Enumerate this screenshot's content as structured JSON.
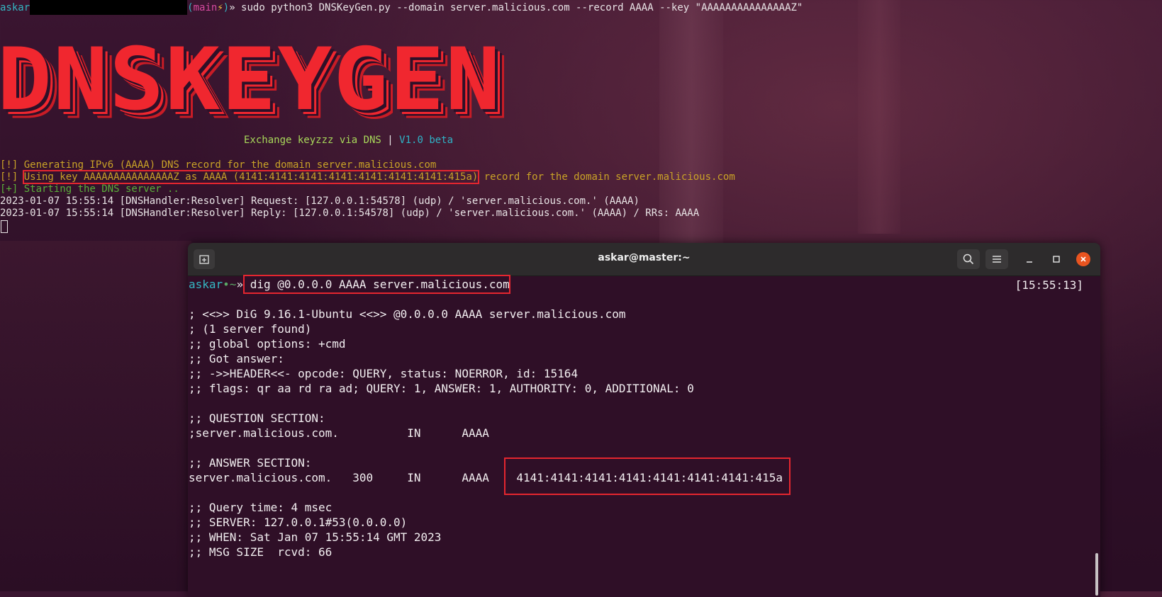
{
  "background_terminal": {
    "prompt_user": "askar",
    "prompt_branch_open": "(",
    "prompt_branch": "main",
    "prompt_bolt": "⚡",
    "prompt_branch_close": ")",
    "prompt_arrow": "»",
    "command": " sudo python3 DNSKeyGen.py --domain server.malicious.com --record AAAA --key \"AAAAAAAAAAAAAAAZ\"",
    "banner": "DNSKEYGEN",
    "tagline_main": "Exchange keyzzz via DNS",
    "tagline_sep": " | ",
    "tagline_version": "V1.0 beta",
    "log_lines": [
      "[!] Generating IPv6 (AAAA) DNS record for the domain server.malicious.com",
      "[!] ",
      "Using key AAAAAAAAAAAAAAAZ as AAAA (4141:4141:4141:4141:4141:4141:4141:415a)",
      " record for the domain server.malicious.com",
      "[+] Starting the DNS server ..",
      "2023-01-07 15:55:14 [DNSHandler:Resolver] Request: [127.0.0.1:54578] (udp) / 'server.malicious.com.' (AAAA)",
      "2023-01-07 15:55:14 [DNSHandler:Resolver] Reply: [127.0.0.1:54578] (udp) / 'server.malicious.com.' (AAAA) / RRs: AAAA"
    ]
  },
  "window": {
    "title": "askar@master:~",
    "new_tab_icon": "new-tab-icon",
    "search_icon": "search-icon",
    "menu_icon": "hamburger-menu-icon",
    "minimize_icon": "minimize-icon",
    "maximize_icon": "maximize-icon",
    "close_icon": "close-icon"
  },
  "foreground_terminal": {
    "prompt_user": "askar",
    "prompt_dot": "•",
    "prompt_tilde": "~",
    "prompt_arrow": "»",
    "command": " dig @0.0.0.0 AAAA server.malicious.com",
    "timestamp": "[15:55:13]",
    "output": [
      "; <<>> DiG 9.16.1-Ubuntu <<>> @0.0.0.0 AAAA server.malicious.com",
      "; (1 server found)",
      ";; global options: +cmd",
      ";; Got answer:",
      ";; ->>HEADER<<- opcode: QUERY, status: NOERROR, id: 15164",
      ";; flags: qr aa rd ra ad; QUERY: 1, ANSWER: 1, AUTHORITY: 0, ADDITIONAL: 0",
      "",
      ";; QUESTION SECTION:",
      ";server.malicious.com.          IN      AAAA",
      "",
      ";; ANSWER SECTION:",
      "server.malicious.com.   300     IN      AAAA    4141:4141:4141:4141:4141:4141:4141:415a",
      "",
      ";; Query time: 4 msec",
      ";; SERVER: 127.0.0.1#53(0.0.0.0)",
      ";; WHEN: Sat Jan 07 15:55:14 GMT 2023",
      ";; MSG SIZE  rcvd: 66"
    ]
  },
  "colors": {
    "accent_red": "#e5262f",
    "banner_red": "#f0272f",
    "prompt_cyan": "#34b7c3",
    "close_orange": "#e95420"
  }
}
